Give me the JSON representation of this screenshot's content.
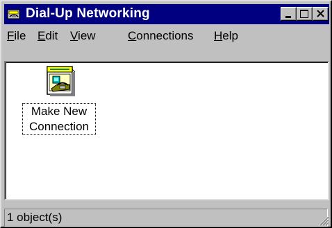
{
  "window": {
    "title": "Dial-Up Networking",
    "title_icon": "dial-up-networking-icon",
    "controls": [
      "minimize",
      "maximize",
      "close"
    ]
  },
  "menubar": {
    "items": [
      {
        "label": "File",
        "accel": "F",
        "rest": "ile"
      },
      {
        "label": "Edit",
        "accel": "E",
        "rest": "dit"
      },
      {
        "label": "View",
        "accel": "V",
        "rest": "iew"
      },
      {
        "label": "Connections",
        "accel": "C",
        "rest": "onnections"
      },
      {
        "label": "Help",
        "accel": "H",
        "rest": "elp"
      }
    ]
  },
  "content": {
    "items": [
      {
        "label_line1": "Make New",
        "label_line2": "Connection",
        "icon": "make-new-connection-icon",
        "selected": true
      }
    ]
  },
  "statusbar": {
    "text": "1 object(s)"
  },
  "colors": {
    "titlebar": "#000080",
    "face": "#c0c0c0",
    "content_bg": "#ffffff"
  }
}
